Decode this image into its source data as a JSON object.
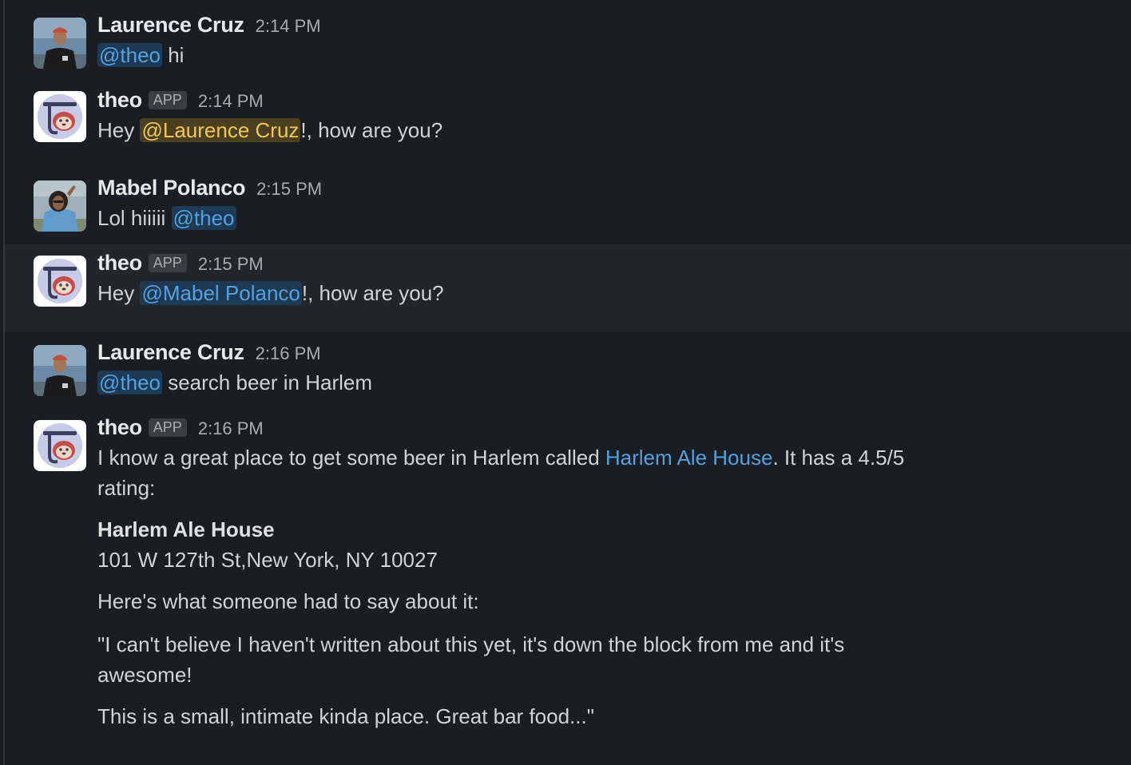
{
  "messages": [
    {
      "sender": "Laurence Cruz",
      "time": "2:14 PM",
      "mention": "@theo",
      "text_after": " hi"
    },
    {
      "sender": "theo",
      "badge": "APP",
      "time": "2:14 PM",
      "text_before": "Hey ",
      "mention": "@Laurence Cruz",
      "text_after": "!, how are you?"
    },
    {
      "sender": "Mabel Polanco",
      "time": "2:15 PM",
      "text_before": "Lol hiiiii ",
      "mention": "@theo"
    },
    {
      "sender": "theo",
      "badge": "APP",
      "time": "2:15 PM",
      "text_before": "Hey ",
      "mention": "@Mabel Polanco",
      "text_after": "!, how are you?"
    },
    {
      "sender": "Laurence Cruz",
      "time": "2:16 PM",
      "mention": "@theo",
      "text_after": " search beer in Harlem"
    },
    {
      "sender": "theo",
      "badge": "APP",
      "time": "2:16 PM",
      "intro_before": "I know a great place to get some beer in Harlem called ",
      "link": "Harlem Ale House",
      "intro_after": ". It has a 4.5/5",
      "intro_line2": "rating:",
      "place_name": "Harlem Ale House",
      "address": "101 W 127th St,New York, NY 10027",
      "review_lead": "Here's what someone had to say about it:",
      "quote_line1": "\"I can't believe I haven't written about this yet, it's down the block from me and it's",
      "quote_line2": "awesome!",
      "quote_line3": "This is a small, intimate kinda place. Great bar food...\""
    }
  ],
  "colors": {
    "background": "#1a1d21",
    "hover_row": "#222529",
    "mention_text": "#4fa3e0",
    "self_mention_text": "#f0c955"
  }
}
